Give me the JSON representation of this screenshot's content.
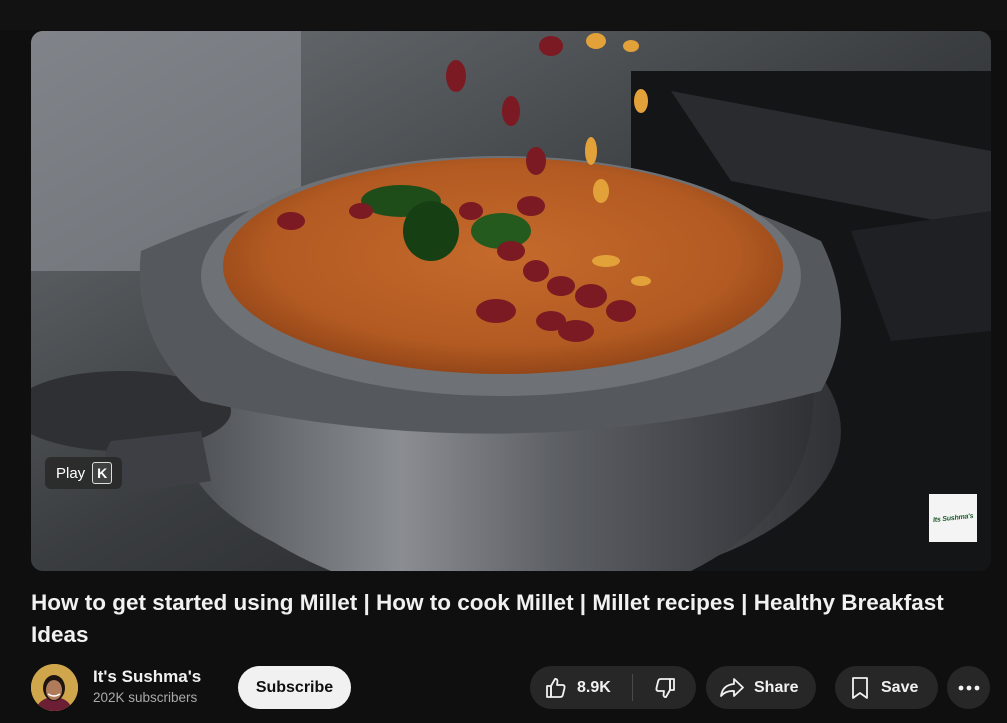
{
  "player": {
    "play_label": "Play",
    "play_shortcut": "K",
    "watermark_text": "Its Sushma's"
  },
  "video": {
    "title": "How to get started using Millet | How to cook Millet | Millet recipes | Healthy Breakfast Ideas"
  },
  "channel": {
    "name": "It's Sushma's",
    "subscribers": "202K subscribers",
    "subscribe_label": "Subscribe"
  },
  "actions": {
    "like_count": "8.9K",
    "share_label": "Share",
    "save_label": "Save"
  },
  "icons": {
    "like": "thumbs-up-icon",
    "dislike": "thumbs-down-icon",
    "share": "share-arrow-icon",
    "save": "bookmark-icon",
    "more": "more-horizontal-icon"
  },
  "colors": {
    "background": "#0f0f0f",
    "pill": "#272727",
    "subscribe_bg": "#f1f1f1",
    "text_primary": "#f1f1f1",
    "text_secondary": "#aaaaaa"
  }
}
